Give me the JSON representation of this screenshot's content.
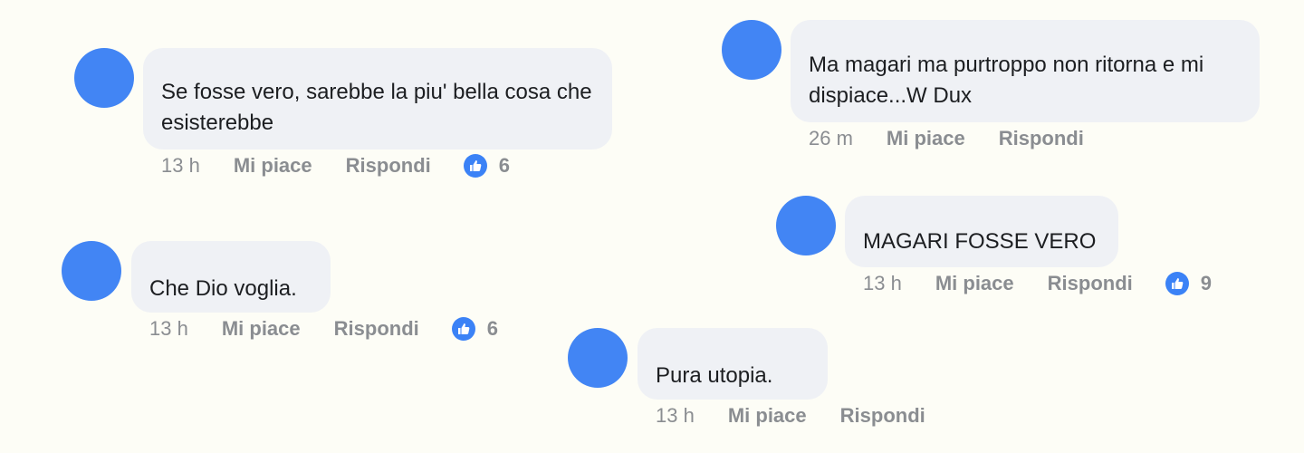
{
  "colors": {
    "background": "#fdfdf6",
    "avatar": "#4285f4",
    "bubble": "#eff1f5",
    "text": "#1c1e21",
    "meta": "#8a8d91",
    "like": "#3b82f6"
  },
  "labels": {
    "like": "Mi piace",
    "reply": "Rispondi"
  },
  "icons": {
    "reaction": "thumbs-up-icon"
  },
  "comments": [
    {
      "text": "Se fosse vero, sarebbe la piu' bella cosa che esisterebbe",
      "time": "13 h",
      "likes": "6"
    },
    {
      "text": "Ma magari ma purtroppo non ritorna e mi dispiace...W Dux",
      "time": "26 m"
    },
    {
      "text": "MAGARI FOSSE VERO",
      "time": "13 h",
      "likes": "9"
    },
    {
      "text": "Che Dio voglia.",
      "time": "13 h",
      "likes": "6"
    },
    {
      "text": "Pura utopia.",
      "time": "13 h"
    }
  ]
}
